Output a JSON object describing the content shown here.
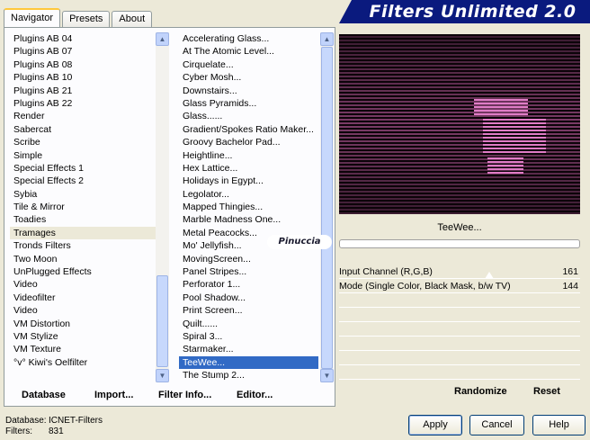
{
  "tabs": [
    "Navigator",
    "Presets",
    "About"
  ],
  "banner": "Filters Unlimited 2.0",
  "categories": [
    "Plugins AB 04",
    "Plugins AB 07",
    "Plugins AB 08",
    "Plugins AB 10",
    "Plugins AB 21",
    "Plugins AB 22",
    "Render",
    "Sabercat",
    "Scribe",
    "Simple",
    "Special Effects 1",
    "Special Effects 2",
    "Sybia",
    "Tile & Mirror",
    "Toadies",
    "Tramages",
    "Tronds Filters",
    "Two Moon",
    "UnPlugged Effects",
    "Video",
    "Videofilter",
    "Video",
    "VM Distortion",
    "VM Stylize",
    "VM Texture",
    "°v° Kiwi's Oelfilter"
  ],
  "selected_category_index": 15,
  "filters": [
    "Accelerating Glass...",
    "At The Atomic Level...",
    "Cirquelate...",
    "Cyber Mosh...",
    "Downstairs...",
    "Glass Pyramids...",
    "Glass......",
    "Gradient/Spokes Ratio Maker...",
    "Groovy Bachelor Pad...",
    "Heightline...",
    "Hex Lattice...",
    "Holidays in Egypt...",
    "Legolator...",
    "Mapped Thingies...",
    "Marble Madness One...",
    "Metal Peacocks...",
    "Mo' Jellyfish...",
    "MovingScreen...",
    "Panel Stripes...",
    "Perforator 1...",
    "Pool Shadow...",
    "Print Screen...",
    "Quilt......",
    "Spiral 3...",
    "Starmaker...",
    "TeeWee...",
    "The Stump 2..."
  ],
  "selected_filter_index": 25,
  "watermark": "Pinuccia",
  "bottom_links": {
    "database": "Database",
    "import": "Import...",
    "filter_info": "Filter Info...",
    "editor": "Editor..."
  },
  "filter_name": "TeeWee...",
  "params": [
    {
      "name": "Input Channel (R,G,B)",
      "value": "161"
    },
    {
      "name": "Mode (Single Color, Black Mask, b/w TV)",
      "value": "144"
    }
  ],
  "randomize": "Randomize",
  "reset": "Reset",
  "status": {
    "db_label": "Database:",
    "db_value": "ICNET-Filters",
    "filters_label": "Filters:",
    "filters_value": "831"
  },
  "buttons": {
    "apply": "Apply",
    "cancel": "Cancel",
    "help": "Help"
  },
  "colors": {
    "banner_bg": "#0a1a7e",
    "selection": "#316ac5",
    "preview_stripe": "#c863a8"
  }
}
